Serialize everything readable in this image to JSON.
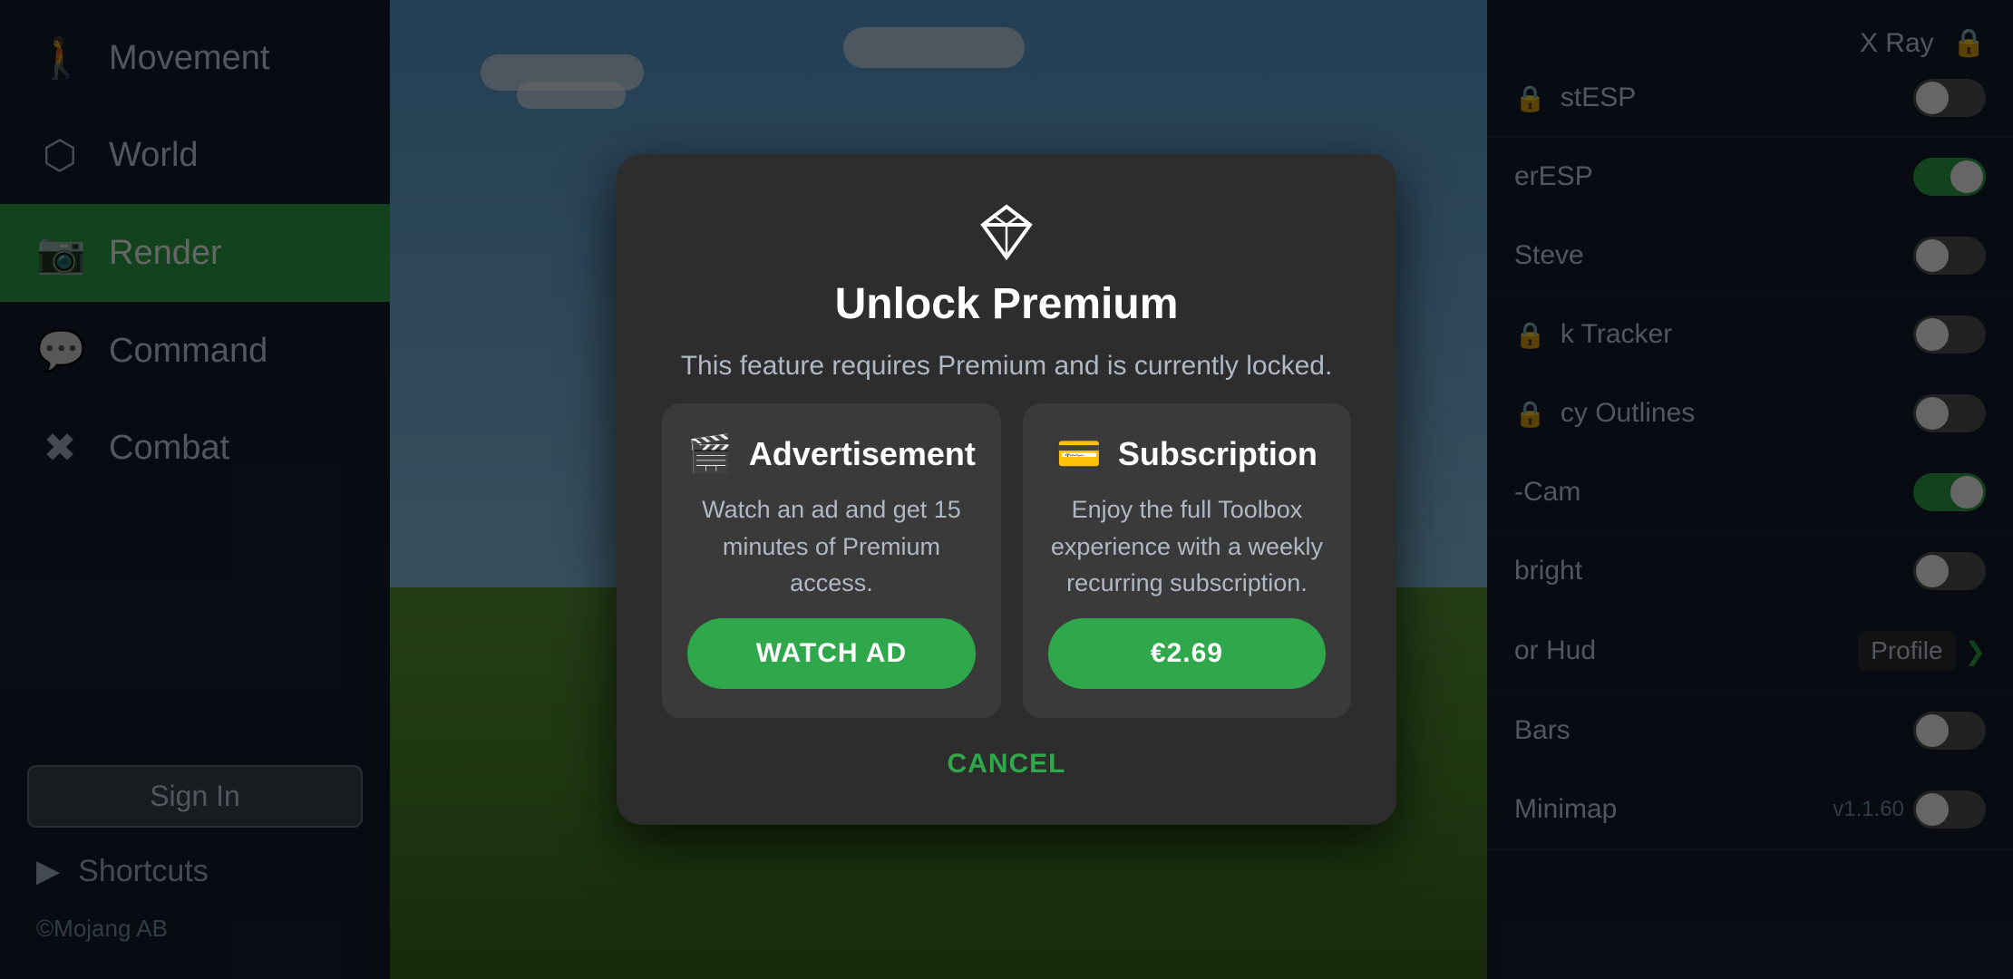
{
  "sidebar": {
    "items": [
      {
        "id": "movement",
        "label": "Movement",
        "icon": "🚶",
        "active": false
      },
      {
        "id": "world",
        "label": "World",
        "icon": "⬡",
        "active": false
      },
      {
        "id": "render",
        "label": "Render",
        "icon": "📷",
        "active": true
      },
      {
        "id": "command",
        "label": "Command",
        "icon": "💬",
        "active": false
      },
      {
        "id": "combat",
        "label": "Combat",
        "icon": "✖",
        "active": false
      }
    ],
    "sign_in_label": "Sign In",
    "shortcuts_label": "Shortcuts",
    "mojang_credit": "©Mojang AB"
  },
  "right_panel": {
    "title": "X Ray",
    "items": [
      {
        "label": "stESP",
        "locked": true,
        "toggle": "off"
      },
      {
        "label": "erESP",
        "toggle": "on"
      },
      {
        "label": "Steve",
        "toggle": "off"
      },
      {
        "label": "k Tracker",
        "locked": true,
        "toggle": "off"
      },
      {
        "label": "cy Outlines",
        "locked": true,
        "toggle": "off"
      },
      {
        "label": "-Cam",
        "toggle": "on"
      },
      {
        "label": "bright",
        "toggle": "off"
      },
      {
        "label": "or Hud",
        "chevron": true
      },
      {
        "label": "Bars",
        "toggle": "off"
      },
      {
        "label": "Minimap",
        "toggle": "off"
      }
    ],
    "profile_label": "Profile",
    "version": "v1.1.60"
  },
  "modal": {
    "title": "Unlock Premium",
    "subtitle": "This feature requires Premium and is currently locked.",
    "ad_card": {
      "icon": "🎬",
      "title": "Advertisement",
      "description": "Watch an ad and get 15 minutes of Premium access.",
      "button_label": "WATCH AD"
    },
    "sub_card": {
      "icon": "💳",
      "title": "Subscription",
      "description": "Enjoy the full Toolbox experience with a weekly recurring subscription.",
      "button_label": "€2.69"
    },
    "cancel_label": "CANCEL"
  }
}
